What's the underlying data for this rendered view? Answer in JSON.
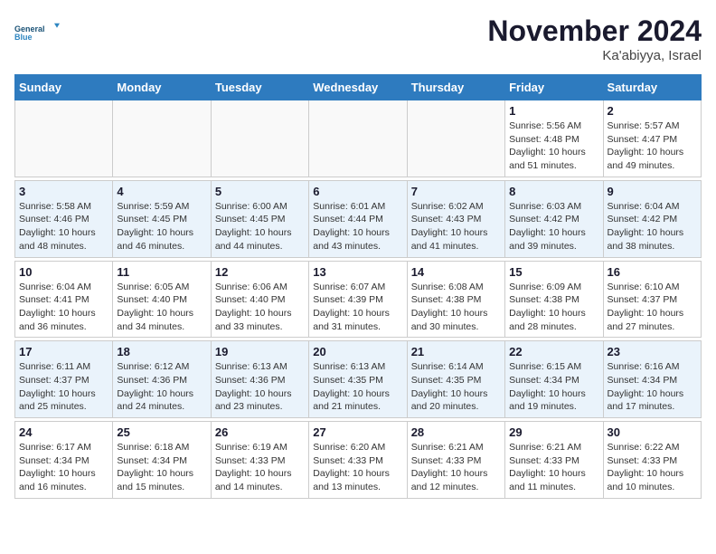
{
  "logo": {
    "text_general": "General",
    "text_blue": "Blue"
  },
  "title": {
    "month_year": "November 2024",
    "location": "Ka'abiyya, Israel"
  },
  "weekdays": [
    "Sunday",
    "Monday",
    "Tuesday",
    "Wednesday",
    "Thursday",
    "Friday",
    "Saturday"
  ],
  "rows": [
    {
      "alt": false,
      "cells": [
        {
          "day": "",
          "info": ""
        },
        {
          "day": "",
          "info": ""
        },
        {
          "day": "",
          "info": ""
        },
        {
          "day": "",
          "info": ""
        },
        {
          "day": "",
          "info": ""
        },
        {
          "day": "1",
          "info": "Sunrise: 5:56 AM\nSunset: 4:48 PM\nDaylight: 10 hours\nand 51 minutes."
        },
        {
          "day": "2",
          "info": "Sunrise: 5:57 AM\nSunset: 4:47 PM\nDaylight: 10 hours\nand 49 minutes."
        }
      ]
    },
    {
      "alt": true,
      "cells": [
        {
          "day": "3",
          "info": "Sunrise: 5:58 AM\nSunset: 4:46 PM\nDaylight: 10 hours\nand 48 minutes."
        },
        {
          "day": "4",
          "info": "Sunrise: 5:59 AM\nSunset: 4:45 PM\nDaylight: 10 hours\nand 46 minutes."
        },
        {
          "day": "5",
          "info": "Sunrise: 6:00 AM\nSunset: 4:45 PM\nDaylight: 10 hours\nand 44 minutes."
        },
        {
          "day": "6",
          "info": "Sunrise: 6:01 AM\nSunset: 4:44 PM\nDaylight: 10 hours\nand 43 minutes."
        },
        {
          "day": "7",
          "info": "Sunrise: 6:02 AM\nSunset: 4:43 PM\nDaylight: 10 hours\nand 41 minutes."
        },
        {
          "day": "8",
          "info": "Sunrise: 6:03 AM\nSunset: 4:42 PM\nDaylight: 10 hours\nand 39 minutes."
        },
        {
          "day": "9",
          "info": "Sunrise: 6:04 AM\nSunset: 4:42 PM\nDaylight: 10 hours\nand 38 minutes."
        }
      ]
    },
    {
      "alt": false,
      "cells": [
        {
          "day": "10",
          "info": "Sunrise: 6:04 AM\nSunset: 4:41 PM\nDaylight: 10 hours\nand 36 minutes."
        },
        {
          "day": "11",
          "info": "Sunrise: 6:05 AM\nSunset: 4:40 PM\nDaylight: 10 hours\nand 34 minutes."
        },
        {
          "day": "12",
          "info": "Sunrise: 6:06 AM\nSunset: 4:40 PM\nDaylight: 10 hours\nand 33 minutes."
        },
        {
          "day": "13",
          "info": "Sunrise: 6:07 AM\nSunset: 4:39 PM\nDaylight: 10 hours\nand 31 minutes."
        },
        {
          "day": "14",
          "info": "Sunrise: 6:08 AM\nSunset: 4:38 PM\nDaylight: 10 hours\nand 30 minutes."
        },
        {
          "day": "15",
          "info": "Sunrise: 6:09 AM\nSunset: 4:38 PM\nDaylight: 10 hours\nand 28 minutes."
        },
        {
          "day": "16",
          "info": "Sunrise: 6:10 AM\nSunset: 4:37 PM\nDaylight: 10 hours\nand 27 minutes."
        }
      ]
    },
    {
      "alt": true,
      "cells": [
        {
          "day": "17",
          "info": "Sunrise: 6:11 AM\nSunset: 4:37 PM\nDaylight: 10 hours\nand 25 minutes."
        },
        {
          "day": "18",
          "info": "Sunrise: 6:12 AM\nSunset: 4:36 PM\nDaylight: 10 hours\nand 24 minutes."
        },
        {
          "day": "19",
          "info": "Sunrise: 6:13 AM\nSunset: 4:36 PM\nDaylight: 10 hours\nand 23 minutes."
        },
        {
          "day": "20",
          "info": "Sunrise: 6:13 AM\nSunset: 4:35 PM\nDaylight: 10 hours\nand 21 minutes."
        },
        {
          "day": "21",
          "info": "Sunrise: 6:14 AM\nSunset: 4:35 PM\nDaylight: 10 hours\nand 20 minutes."
        },
        {
          "day": "22",
          "info": "Sunrise: 6:15 AM\nSunset: 4:34 PM\nDaylight: 10 hours\nand 19 minutes."
        },
        {
          "day": "23",
          "info": "Sunrise: 6:16 AM\nSunset: 4:34 PM\nDaylight: 10 hours\nand 17 minutes."
        }
      ]
    },
    {
      "alt": false,
      "cells": [
        {
          "day": "24",
          "info": "Sunrise: 6:17 AM\nSunset: 4:34 PM\nDaylight: 10 hours\nand 16 minutes."
        },
        {
          "day": "25",
          "info": "Sunrise: 6:18 AM\nSunset: 4:34 PM\nDaylight: 10 hours\nand 15 minutes."
        },
        {
          "day": "26",
          "info": "Sunrise: 6:19 AM\nSunset: 4:33 PM\nDaylight: 10 hours\nand 14 minutes."
        },
        {
          "day": "27",
          "info": "Sunrise: 6:20 AM\nSunset: 4:33 PM\nDaylight: 10 hours\nand 13 minutes."
        },
        {
          "day": "28",
          "info": "Sunrise: 6:21 AM\nSunset: 4:33 PM\nDaylight: 10 hours\nand 12 minutes."
        },
        {
          "day": "29",
          "info": "Sunrise: 6:21 AM\nSunset: 4:33 PM\nDaylight: 10 hours\nand 11 minutes."
        },
        {
          "day": "30",
          "info": "Sunrise: 6:22 AM\nSunset: 4:33 PM\nDaylight: 10 hours\nand 10 minutes."
        }
      ]
    }
  ]
}
